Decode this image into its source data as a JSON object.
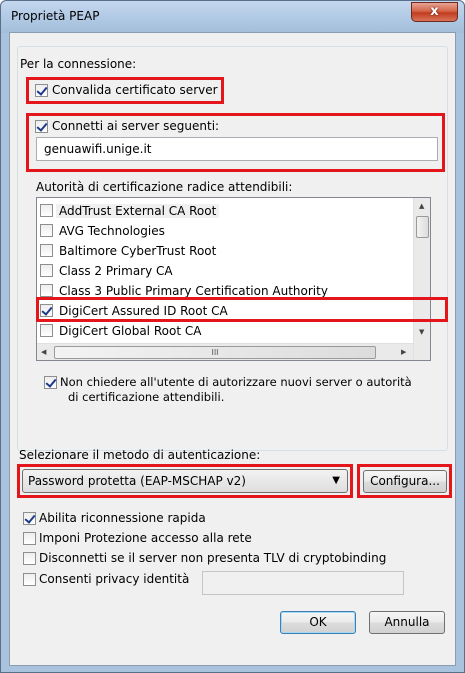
{
  "window": {
    "title": "Proprietà PEAP",
    "close_symbol": "x"
  },
  "connection": {
    "heading": "Per la connessione:",
    "validate_cert": {
      "label": "Convalida certificato server",
      "checked": true
    },
    "connect_servers": {
      "label": "Connetti ai server seguenti:",
      "checked": true
    },
    "server_value": "genuawifi.unige.it"
  },
  "ca_list": {
    "heading": "Autorità di certificazione radice attendibili:",
    "items": [
      {
        "label": "AddTrust External CA Root",
        "checked": false
      },
      {
        "label": "AVG Technologies",
        "checked": false
      },
      {
        "label": "Baltimore CyberTrust Root",
        "checked": false
      },
      {
        "label": "Class 2 Primary CA",
        "checked": false
      },
      {
        "label": "Class 3 Public Primary Certification Authority",
        "checked": false
      },
      {
        "label": "DigiCert Assured ID Root CA",
        "checked": true
      },
      {
        "label": "DigiCert Global Root CA",
        "checked": false
      }
    ],
    "scroll_grip": "III"
  },
  "no_prompt": {
    "line1": "Non chiedere all'utente di autorizzare nuovi server o autorità",
    "line2": "di certificazione attendibili.",
    "checked": true
  },
  "auth": {
    "heading": "Selezionare il metodo di autenticazione:",
    "selected": "Password protetta (EAP-MSCHAP v2)",
    "configure_label": "Configura..."
  },
  "options": [
    {
      "label": "Abilita riconnessione rapida",
      "checked": true
    },
    {
      "label": "Imponi Protezione accesso alla rete",
      "checked": false
    },
    {
      "label": "Disconnetti se il server non presenta TLV di cryptobinding",
      "checked": false
    },
    {
      "label": "Consenti privacy identità",
      "checked": false
    }
  ],
  "buttons": {
    "ok": "OK",
    "cancel": "Annulla"
  },
  "colors": {
    "highlight": "#e4161b",
    "frame": "#a9c2dd"
  }
}
